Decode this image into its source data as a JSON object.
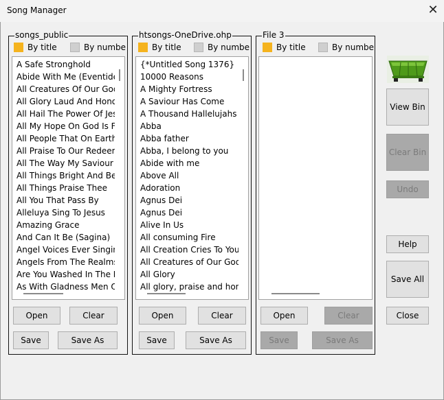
{
  "window": {
    "title": "Song Manager"
  },
  "panels": [
    {
      "title": "songs_public",
      "sort_title": "By title",
      "sort_number": "By numbe",
      "items": [
        "A Safe Stronghold",
        "Abide With Me (Eventide)",
        "All Creatures Of Our God A",
        "All Glory Laud And Honour",
        "All Hail The Power Of Jesus",
        "All My Hope On God Is Fou",
        "All People That On Earth D",
        "All Praise To Our Redeemi",
        "All The Way My Saviour Le",
        "All Things Bright And Beau",
        "All Things Praise Thee",
        "All You That Pass By",
        "Alleluya Sing To Jesus",
        "Amazing Grace",
        "And Can It Be (Sagina)",
        "Angel Voices Ever Singing",
        "Angels From The Realms C",
        "Are You Washed In The Bl",
        "As With Gladness Men Of"
      ],
      "open": "Open",
      "clear": "Clear",
      "save": "Save",
      "save_as": "Save As"
    },
    {
      "title": "htsongs-OneDrive.ohp",
      "sort_title": "By title",
      "sort_number": "By numbe",
      "items": [
        "{*Untitled Song 1376}",
        "10000 Reasons",
        "A Mighty Fortress",
        "A Saviour Has Come",
        "A Thousand Hallelujahs",
        "Abba",
        "Abba father",
        "Abba, I belong to you",
        "Abide with me",
        "Above All",
        "Adoration",
        "Agnus Dei",
        "Agnus Dei",
        "Alive In Us",
        "All consuming Fire",
        "All Creation Cries To You",
        "All Creatures of Our God a",
        "All Glory",
        "All glory, praise and honou"
      ],
      "open": "Open",
      "clear": "Clear",
      "save": "Save",
      "save_as": "Save As"
    },
    {
      "title": "File 3",
      "sort_title": "By title",
      "sort_number": "By numbe",
      "items": [],
      "open": "Open",
      "clear": "Clear",
      "save": "Save",
      "save_as": "Save As"
    }
  ],
  "sidebar": {
    "view_bin": "View Bin",
    "clear_bin": "Clear Bin",
    "undo": "Undo",
    "help": "Help",
    "save_all": "Save All",
    "close": "Close"
  },
  "colors": {
    "selected_swatch": "#f5b31e",
    "bin_green": "#4e9a1a"
  },
  "icons": {
    "bin": "skip-bin-icon",
    "close": "close-icon"
  }
}
